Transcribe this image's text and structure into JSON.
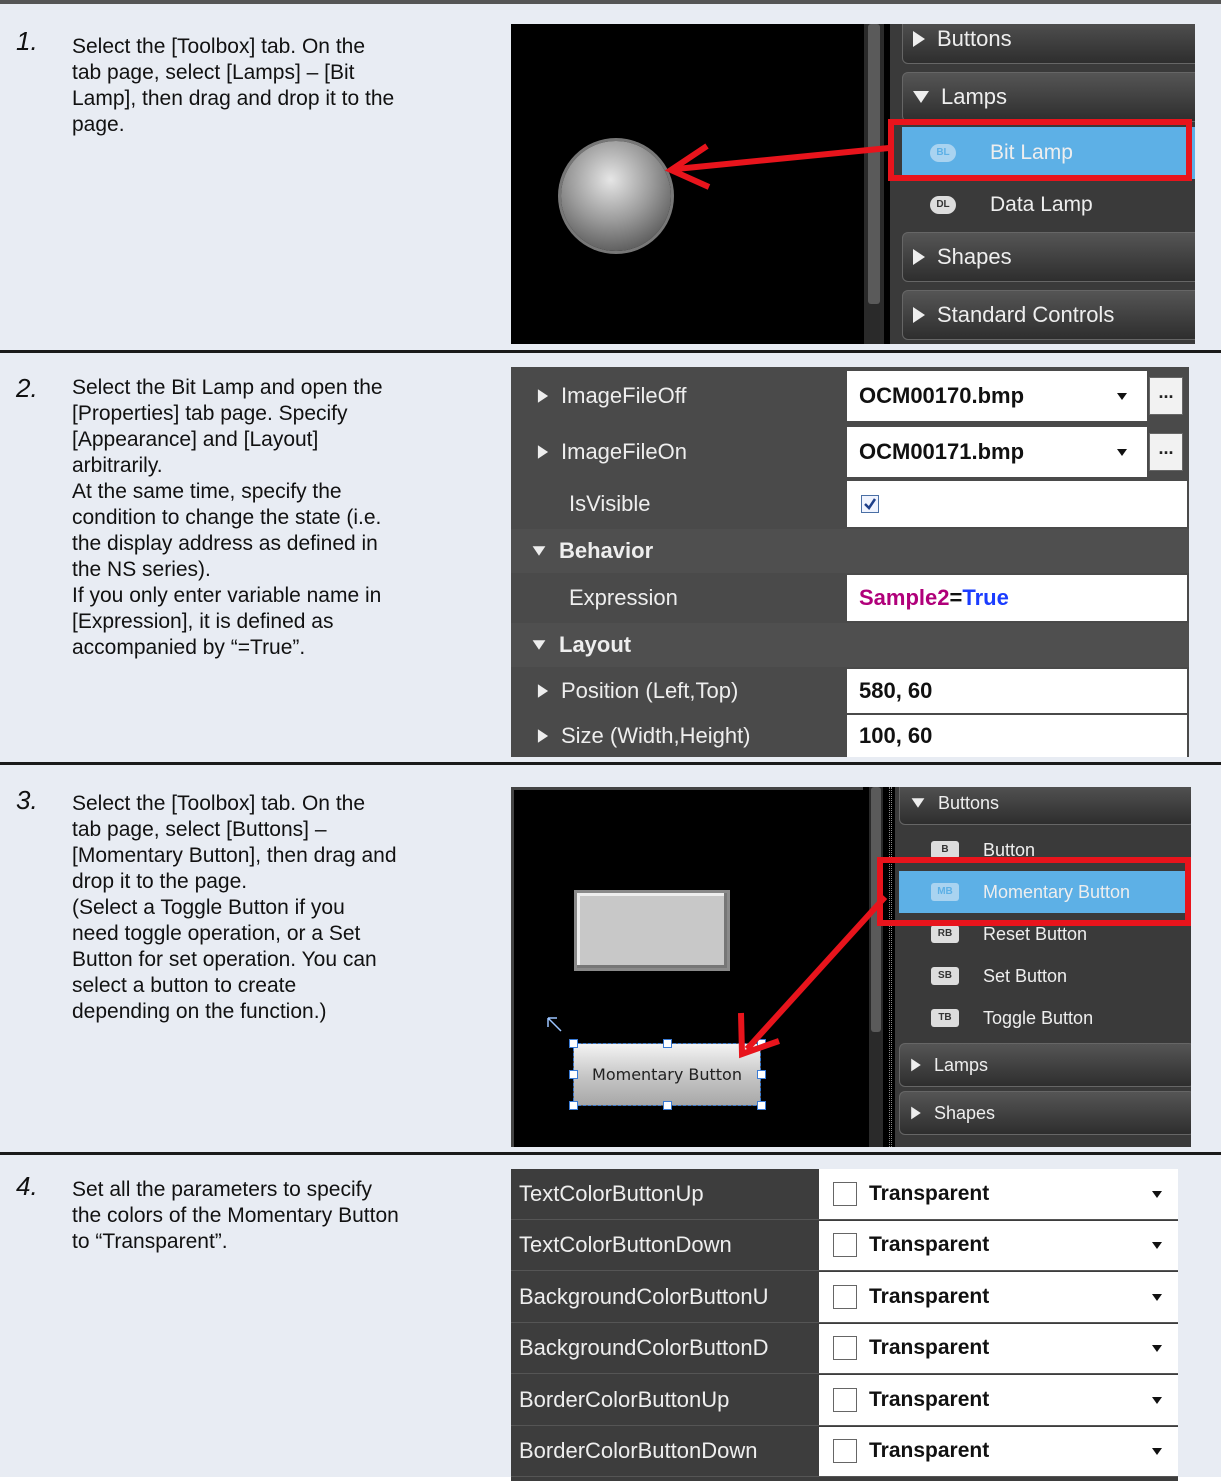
{
  "steps": [
    {
      "num": "1.",
      "text": "Select the [Toolbox] tab. On the\ntab page, select [Lamps] – [Bit\nLamp], then drag and drop it to the\npage."
    },
    {
      "num": "2.",
      "text": "Select the Bit Lamp and open the\n[Properties] tab page. Specify\n[Appearance] and [Layout]\narbitrarily.\nAt the same time, specify the\ncondition to change the state (i.e.\nthe display address as defined in\nthe NS series).\nIf you only enter variable name in\n[Expression], it is defined as\naccompanied by “=True”."
    },
    {
      "num": "3.",
      "text": "Select the [Toolbox] tab. On the\ntab page, select [Buttons] –\n[Momentary Button], then drag and\ndrop it to the page.\n(Select a Toggle Button if you\nneed toggle operation, or a Set\nButton for set operation. You can\nselect a button to create\ndepending on the function.)"
    },
    {
      "num": "4.",
      "text": "Set all the parameters to specify\nthe colors of the Momentary Button\nto “Transparent”."
    }
  ],
  "shot1": {
    "groups": [
      "Buttons",
      "Lamps",
      "Shapes",
      "Standard Controls"
    ],
    "items": [
      {
        "icon": "BL",
        "label": "Bit Lamp"
      },
      {
        "icon": "DL",
        "label": "Data Lamp"
      }
    ]
  },
  "shot2": {
    "rows": [
      {
        "name": "ImageFileOff",
        "value": "OCM00170.bmp"
      },
      {
        "name": "ImageFileOn",
        "value": "OCM00171.bmp"
      },
      {
        "name": "IsVisible",
        "value": ""
      },
      {
        "name": "Behavior",
        "value": ""
      },
      {
        "name": "Expression",
        "value": ""
      },
      {
        "name": "Layout",
        "value": ""
      },
      {
        "name": "Position (Left,Top)",
        "value": "580, 60"
      },
      {
        "name": "Size (Width,Height)",
        "value": "100, 60"
      }
    ],
    "expression_var": "Sample2",
    "expression_op": "=",
    "expression_val": "True",
    "ellipsis": "...",
    "colors": {
      "variable": "#b0007a",
      "keyword": "#1a3cff"
    }
  },
  "shot3": {
    "groups": [
      "Buttons",
      "Lamps",
      "Shapes"
    ],
    "items": [
      {
        "icon": "B",
        "label": "Button"
      },
      {
        "icon": "MB",
        "label": "Momentary Button"
      },
      {
        "icon": "RB",
        "label": "Reset Button"
      },
      {
        "icon": "SB",
        "label": "Set Button"
      },
      {
        "icon": "TB",
        "label": "Toggle Button"
      }
    ],
    "canvas_button_label": "Momentary Button"
  },
  "shot4": {
    "rows": [
      {
        "name": "TextColorButtonUp",
        "value": "Transparent"
      },
      {
        "name": "TextColorButtonDown",
        "value": "Transparent"
      },
      {
        "name": "BackgroundColorButtonU",
        "value": "Transparent"
      },
      {
        "name": "BackgroundColorButtonD",
        "value": "Transparent"
      },
      {
        "name": "BorderColorButtonUp",
        "value": "Transparent"
      },
      {
        "name": "BorderColorButtonDown",
        "value": "Transparent"
      }
    ]
  },
  "colors": {
    "highlight": "#e8141c",
    "selected": "#5db0e6",
    "panel_bg": "#e8ecf3"
  }
}
